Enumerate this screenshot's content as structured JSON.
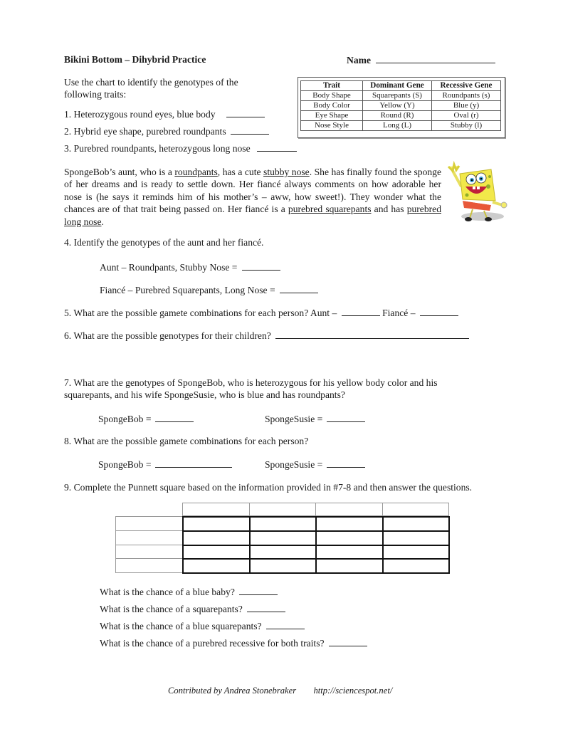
{
  "header": {
    "title": "Bikini Bottom – Dihybrid Practice",
    "name_label": "Name"
  },
  "intro": {
    "line1": "Use the chart to identify the genotypes of the",
    "line2": "following traits:"
  },
  "trait_table": {
    "headers": [
      "Trait",
      "Dominant Gene",
      "Recessive Gene"
    ],
    "rows": [
      [
        "Body Shape",
        "Squarepants (S)",
        "Roundpants (s)"
      ],
      [
        "Body Color",
        "Yellow (Y)",
        "Blue (y)"
      ],
      [
        "Eye Shape",
        "Round (R)",
        "Oval (r)"
      ],
      [
        "Nose Style",
        "Long (L)",
        "Stubby (l)"
      ]
    ]
  },
  "questions_1_3": [
    "1. Heterozygous round eyes, blue body",
    "2. Hybrid eye shape, purebred roundpants",
    "3. Purebred roundpants, heterozygous long nose"
  ],
  "story": {
    "p1": "SpongeBob’s aunt, who is a ",
    "u1": "roundpants",
    "p2": ", has a cute ",
    "u2": "stubby nose",
    "p3": ".  She has finally found the sponge of her dreams and is ready to settle down.  Her fiancé always comments on how adorable her nose is (he says it reminds him of his mother’s – aww, how sweet!).  They wonder what the chances are of that trait being passed on.  Her fiancé is a ",
    "u3": "purebred squarepants",
    "p4": " and has ",
    "u4": "purebred long nose",
    "p5": "."
  },
  "image": {
    "alt": "SpongeBob waving"
  },
  "q4": {
    "prompt": "4. Identify the genotypes of the aunt and her fiancé.",
    "aunt": "Aunt – Roundpants, Stubby Nose =",
    "fiance": "Fiancé – Purebred Squarepants, Long Nose ="
  },
  "q5": {
    "prompt": "5.  What are the possible gamete combinations for each person? Aunt –",
    "fiance_label": "Fiancé –"
  },
  "q6": {
    "prompt": "6.  What are the possible genotypes for their children?"
  },
  "q7": {
    "line1": "7.   What are the genotypes of SpongeBob, who is heterozygous for his yellow body color and his",
    "line2": "squarepants, and his wife SpongeSusie, who is blue and has roundpants?",
    "spongebob": "SpongeBob =",
    "spongesusie": "SpongeSusie ="
  },
  "q8": {
    "prompt": "8.  What are the possible gamete combinations for each person?",
    "spongebob": "SpongeBob =",
    "spongesusie": "SpongeSusie ="
  },
  "q9": {
    "prompt": "9. Complete the Punnett square based on the information provided in #7-8 and then answer the questions.",
    "punnett": {
      "columns": 4,
      "rows": 4
    },
    "followups": [
      "What is the chance of a blue baby?",
      "What is the chance of a squarepants?",
      "What is the chance of a blue squarepants?",
      "What is the chance of a purebred recessive for both traits?"
    ]
  },
  "footer": {
    "credit": "Contributed by Andrea Stonebraker",
    "url": "http://sciencespot.net/"
  }
}
